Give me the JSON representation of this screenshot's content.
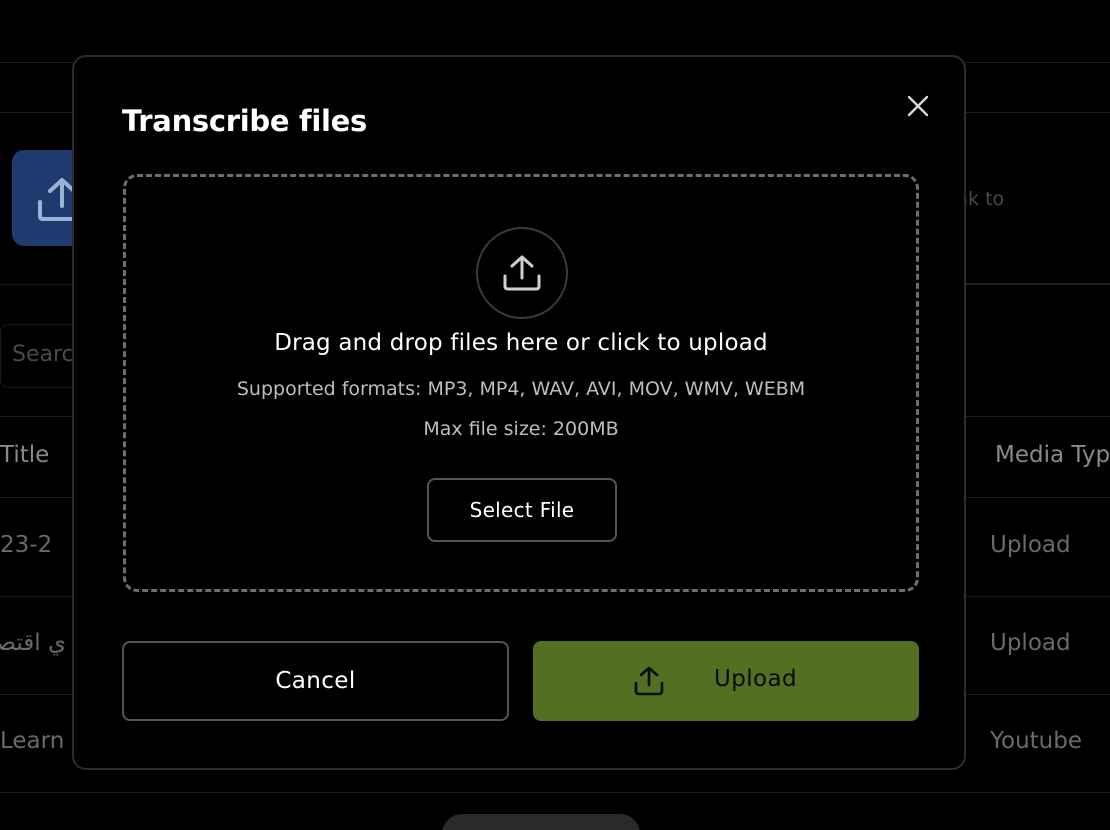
{
  "background": {
    "link_card_text": "nk to",
    "search_placeholder": "Searc",
    "table": {
      "columns": {
        "title": "Title",
        "media_type": "Media Typ"
      },
      "rows": [
        {
          "title": "23-2",
          "media_type": "Upload"
        },
        {
          "title": "ي اقتصا",
          "media_type": "Upload"
        },
        {
          "title": "Learn",
          "media_type": "Youtube"
        }
      ]
    }
  },
  "modal": {
    "title": "Transcribe files",
    "close_icon": "close-icon",
    "dropzone": {
      "icon": "upload-icon",
      "headline": "Drag and drop files here or click to upload",
      "formats": "Supported formats: MP3, MP4, WAV, AVI, MOV, WMV, WEBM",
      "max_size": "Max file size: 200MB",
      "select_button": "Select File"
    },
    "actions": {
      "cancel": "Cancel",
      "upload": "Upload",
      "upload_icon": "upload-icon"
    }
  },
  "colors": {
    "upload_button": "#536f22",
    "background": "#000000",
    "dropzone_border": "#6e6e6e",
    "bg_upload_card": "#1e3a6e"
  }
}
